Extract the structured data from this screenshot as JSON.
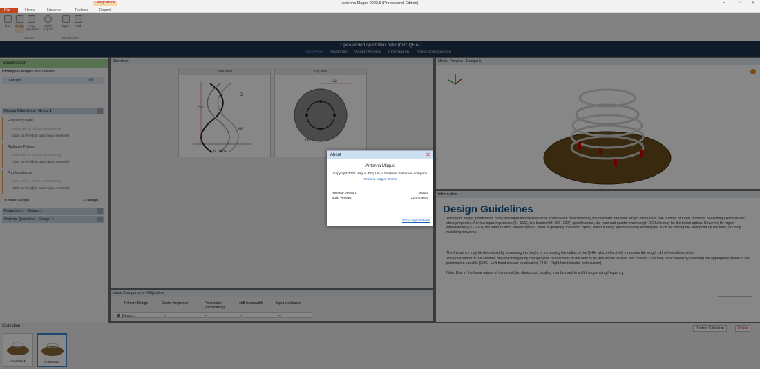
{
  "window": {
    "title": "Antenna Magus 2022.5 (Professional Edition)",
    "minimize": "–",
    "maximize": "□",
    "close": "✕"
  },
  "menu": {
    "file": "File",
    "tabs": [
      "Home",
      "Libraries",
      "Toolbox"
    ],
    "context_title": "Design Mode",
    "context_tab": "Export"
  },
  "ribbon": {
    "buttons": [
      {
        "label": "Find",
        "icon": "find-icon"
      },
      {
        "label": "Design",
        "icon": "design-icon"
      },
      {
        "label": "Array Synthesis",
        "icon": "array-icon"
      },
      {
        "label": "Model Export",
        "icon": "model-export-icon"
      },
      {
        "label": "Open",
        "icon": "open-icon"
      },
      {
        "label": "Add",
        "icon": "add-icon"
      }
    ],
    "group_magus": "Magus",
    "group_info": "Info Browser"
  },
  "header": {
    "title": "Open-ended quadrifilar helix (O-C QHA)",
    "nav": [
      "Overview",
      "Sketches",
      "Model Preview",
      "Information",
      "Value Comparison"
    ]
  },
  "left": {
    "specification": "Specification",
    "prototype": "Prototype Designs and Tweaks",
    "design1": "Design 1",
    "objectives": "Design Objectives - Group 1",
    "boxes": [
      {
        "label": "Frequency Band",
        "auto": "Values will be chosen automatically",
        "hint": "(Click on the (d) to switch input methods)"
      },
      {
        "label": "Radiation Pattern",
        "auto": "Values will be chosen automatically",
        "hint": "(Click on the (d) to switch input methods)"
      },
      {
        "label": "Port Impedance",
        "auto": "Values will be chosen automatically",
        "hint": "(Click on the (d) to switch input methods)"
      }
    ],
    "new_design": "New Design",
    "design_btn": "Design",
    "parameters": "Parameters - Design 1",
    "derived": "Derived Quantities - Design 1"
  },
  "sketches": {
    "title": "Sketches",
    "side": "Side view",
    "top": "Top view",
    "labels": {
      "hn": "Hn",
      "d": "D",
      "hf": "Hf",
      "nturns": "N turns",
      "dg": "Dg",
      "dn": "Dn"
    }
  },
  "valcomp": {
    "title": "Value Comparison - Objectives",
    "columns": [
      "Primary Design",
      "Centre frequency",
      "Polarisation (transmitting)",
      "3dB beamwidth",
      "Input resistance"
    ],
    "row": [
      "Design 1",
      "–",
      "–",
      "–",
      "–"
    ]
  },
  "model": {
    "title": "Model Preview",
    "tab": "Design 1"
  },
  "info": {
    "title": "Information",
    "heading": "Design Guidelines",
    "p1": "The beam shape, polarisation purity and input impedance of the antenna are determined by the diameter and axial length of the helix, the number of turns, diameter of exciting elements and other properties. For low input impedance (5 - 15Ω), low beamwidth (90 - 120°) specifications, the resonant quarter-wavelength OC helix may be the better option. However, for higher impedances (15 - 70Ω), the three-quarter wavelength OC helix is generally the better option, without using special feeding techniques, such as shifting the feed point up the helix, or using matching networks.",
    "b1": "The frequency may be decreased by increasing the height or increasing the radius of the QHA, which effectively increases the length of the helical elements.",
    "b2": "The polarisation of the antenna may be changed by changing the handedness of the helices as well as the various port phases. This may be achieved by selecting the appropriate option in the polarisation variable (LHC - Left-hand circular polarisation, RHC - Right-hand circular polarisation).",
    "note": "Note: Due to the linear nature of the model (no dielectrics), scaling may be used to shift the operating frequency."
  },
  "collection": {
    "title": "Collection",
    "items": [
      "Antenna 1",
      "Antenna 2"
    ],
    "restore": "Restore Collection",
    "delete": "Delete"
  },
  "about": {
    "title": "About",
    "product": "Antenna Magus",
    "copyright": "Copyright 2022 Magus (Pty) Ltd, a Dassault Systèmes company",
    "link": "Antenna Magus Online",
    "release_label": "Release Version:",
    "release": "2022.5",
    "build_label": "Build Version:",
    "build": "12.5.0.8016",
    "legal": "Show legal notices"
  }
}
